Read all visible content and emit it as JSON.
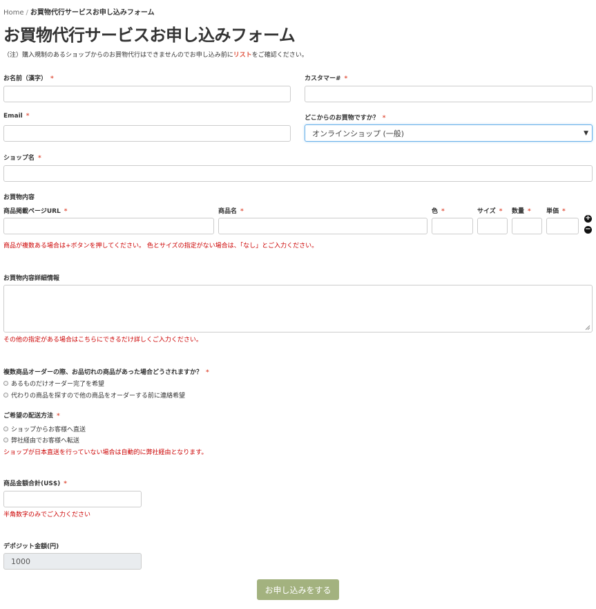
{
  "breadcrumb": {
    "home": "Home",
    "separator": "/",
    "current": "お買物代行サービスお申し込みフォーム"
  },
  "page_title": "お買物代行サービスお申し込みフォーム",
  "notice": {
    "prefix": "（注）購入規制のあるショップからのお買物代行はできませんのでお申し込み前に",
    "link": "リスト",
    "suffix": "をご確認ください。"
  },
  "required_mark": "*",
  "fields": {
    "name": {
      "label": "お名前（漢字）",
      "value": ""
    },
    "customer_no": {
      "label": "カスタマー#",
      "value": ""
    },
    "email": {
      "label": "Email",
      "value": ""
    },
    "shop_type": {
      "label": "どこからのお買物ですか？",
      "selected": "オンラインショップ (一般)"
    },
    "shop_name": {
      "label": "ショップ名",
      "value": ""
    }
  },
  "items": {
    "section_label": "お買物内容",
    "columns": {
      "url": "商品掲載ページURL",
      "name": "商品名",
      "color": "色",
      "size": "サイズ",
      "qty": "数量",
      "price": "単価"
    },
    "help": "商品が複数ある場合は+ボタンを押してください。 色とサイズの指定がない場合は、「なし」とご入力ください。",
    "add_symbol": "+",
    "remove_symbol": "−"
  },
  "details": {
    "label": "お買物内容詳細情報",
    "value": "",
    "help": "その他の指定がある場合はこちらにできるだけ詳しくご入力ください。"
  },
  "out_of_stock": {
    "label": "複数商品オーダーの際、お品切れの商品があった場合どうされますか？",
    "options": [
      "あるものだけオーダー完了を希望",
      "代わりの商品を探すので他の商品をオーダーする前に連絡希望"
    ]
  },
  "delivery": {
    "label": "ご希望の配送方法",
    "options": [
      "ショップからお客様へ直送",
      "弊社経由でお客様へ転送"
    ],
    "help": "ショップが日本直送を行っていない場合は自動的に弊社経由となります。"
  },
  "total": {
    "label": "商品金額合計(US$)",
    "value": "",
    "help": "半角数字のみでご入力ください"
  },
  "deposit": {
    "label": "デポジット金額(円)",
    "value": "1000"
  },
  "submit_label": "お申し込みをする",
  "colors": {
    "required": "#e0533f",
    "help": "#cc0000",
    "submit_bg": "#a3b27f",
    "link": "#e0533f"
  }
}
